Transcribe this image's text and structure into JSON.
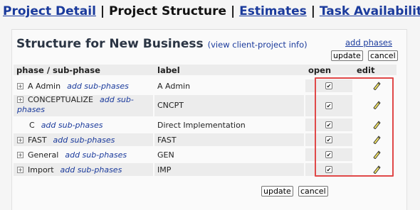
{
  "nav": {
    "project_detail": "Project Detail",
    "project_structure": "Project Structure",
    "estimates": "Estimates",
    "task_availability": "Task Availability",
    "separator": "|"
  },
  "panel": {
    "title": "Structure for New Business",
    "view_info": "(view client-project info)",
    "add_phases": "add phases",
    "update_label": "update",
    "cancel_label": "cancel"
  },
  "table": {
    "headers": {
      "phase": "phase / sub-phase",
      "label": "label",
      "open": "open",
      "edit": "edit"
    },
    "add_sub_label": "add sub-phases",
    "rows": [
      {
        "phase": "A Admin",
        "label": "A Admin",
        "open": true
      },
      {
        "phase": "CONCEPTUALIZE",
        "label": "CNCPT",
        "open": true
      },
      {
        "phase": "C",
        "label": "Direct Implementation",
        "open": true
      },
      {
        "phase": "FAST",
        "label": "FAST",
        "open": true
      },
      {
        "phase": "General",
        "label": "GEN",
        "open": true
      },
      {
        "phase": "Import",
        "label": "IMP",
        "open": true
      }
    ]
  },
  "icons": {
    "expander": "plus-box-icon",
    "checkbox": "checkbox-checked-icon",
    "edit": "pencil-icon"
  },
  "colors": {
    "link": "#1a3a9c",
    "title": "#2b3544",
    "highlight": "#e04848",
    "pencil": "#f5e663"
  }
}
